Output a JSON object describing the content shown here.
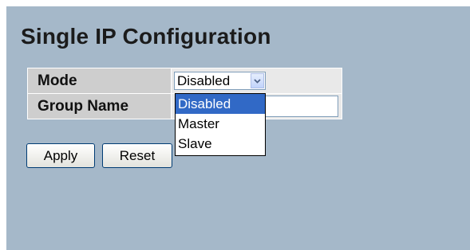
{
  "page": {
    "title": "Single IP Configuration"
  },
  "form": {
    "mode_label": "Mode",
    "mode_value": "Disabled",
    "group_name_label": "Group Name",
    "group_name_value": ""
  },
  "dropdown": {
    "options": [
      "Disabled",
      "Master",
      "Slave"
    ],
    "selected_index": 0
  },
  "buttons": {
    "apply_label": "Apply",
    "reset_label": "Reset"
  },
  "colors": {
    "panel_background": "#a5b8c9",
    "label_cell": "#cecece",
    "value_cell": "#e9e9e9",
    "selected_option": "#3169c6"
  },
  "icons": {
    "select_arrow": "chevron-down-icon"
  }
}
